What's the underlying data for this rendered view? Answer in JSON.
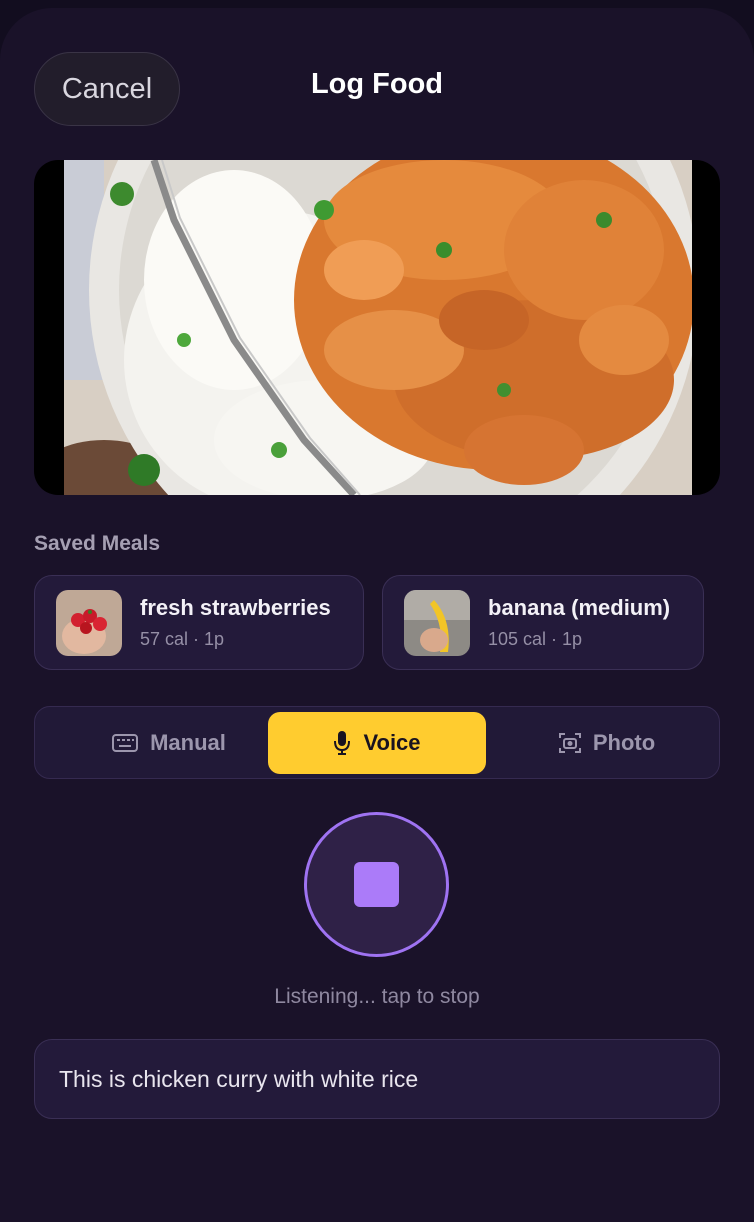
{
  "header": {
    "cancel_label": "Cancel",
    "title": "Log Food"
  },
  "photo": {
    "subject": "chicken curry with white rice"
  },
  "saved_meals": {
    "label": "Saved Meals",
    "items": [
      {
        "name": "fresh strawberries",
        "meta": "57 cal · 1p",
        "icon": "strawberry-thumbnail"
      },
      {
        "name": "banana (medium)",
        "meta": "105 cal · 1p",
        "icon": "banana-thumbnail"
      }
    ]
  },
  "modes": {
    "items": [
      {
        "label": "Manual",
        "icon": "keyboard-icon"
      },
      {
        "label": "Voice",
        "icon": "microphone-icon"
      },
      {
        "label": "Photo",
        "icon": "camera-icon"
      }
    ],
    "selected": "Voice"
  },
  "recorder": {
    "status": "Listening... tap to stop",
    "transcript": "This is chicken curry with white rice"
  },
  "colors": {
    "accent": "#ffcc2f",
    "record": "#ab7bf9",
    "background": "#1a1229",
    "card": "#231a3a"
  }
}
